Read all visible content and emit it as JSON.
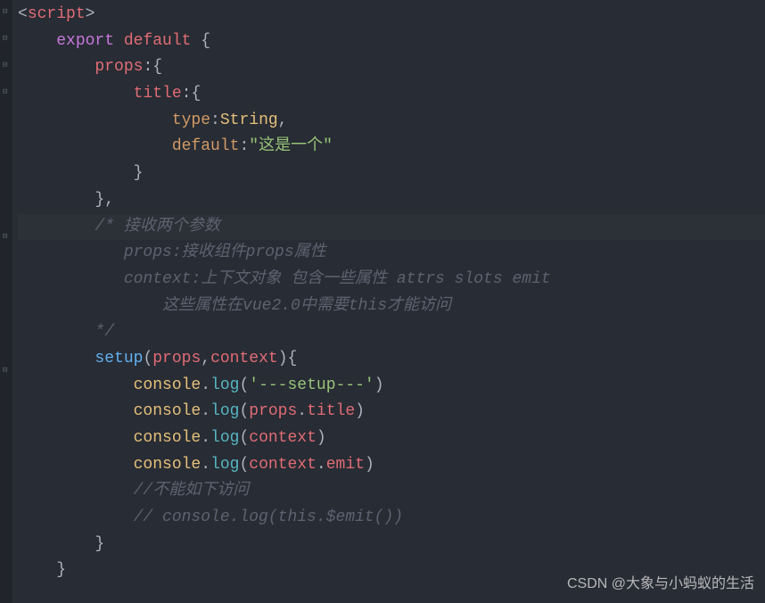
{
  "code": {
    "line1": {
      "open": "<",
      "tag": "script",
      "close": ">"
    },
    "line2": {
      "kw1": "export",
      "kw2": "default",
      "brace": " {"
    },
    "line3": {
      "prop": "props",
      "rest": ":{"
    },
    "line4": {
      "prop": "title",
      "rest": ":{"
    },
    "line5": {
      "prop": "type",
      "colon": ":",
      "val": "String",
      "comma": ","
    },
    "line6": {
      "prop": "default",
      "colon": ":",
      "val": "\"这是一个\""
    },
    "line7": "}",
    "line8": "},",
    "line9": "/* 接收两个参数",
    "line10": "   props:接收组件props属性",
    "line11": "   context:上下文对象 包含一些属性 attrs slots emit",
    "line12": "       这些属性在vue2.0中需要this才能访问",
    "line13": "*/",
    "line14": {
      "func": "setup",
      "open": "(",
      "p1": "props",
      "comma": ",",
      "p2": "context",
      "close": "){"
    },
    "line15": {
      "obj": "console",
      "dot": ".",
      "method": "log",
      "open": "(",
      "str": "'---setup---'",
      "close": ")"
    },
    "line16": {
      "obj": "console",
      "dot": ".",
      "method": "log",
      "open": "(",
      "arg1": "props",
      "dot2": ".",
      "arg2": "title",
      "close": ")"
    },
    "line17": {
      "obj": "console",
      "dot": ".",
      "method": "log",
      "open": "(",
      "arg": "context",
      "close": ")"
    },
    "line18": {
      "obj": "console",
      "dot": ".",
      "method": "log",
      "open": "(",
      "arg1": "context",
      "dot2": ".",
      "arg2": "emit",
      "close": ")"
    },
    "line19": "//不能如下访问",
    "line20": "// console.log(this.$emit())",
    "line21": "}",
    "line22": "}"
  },
  "watermark": "CSDN @大象与小蚂蚁的生活"
}
